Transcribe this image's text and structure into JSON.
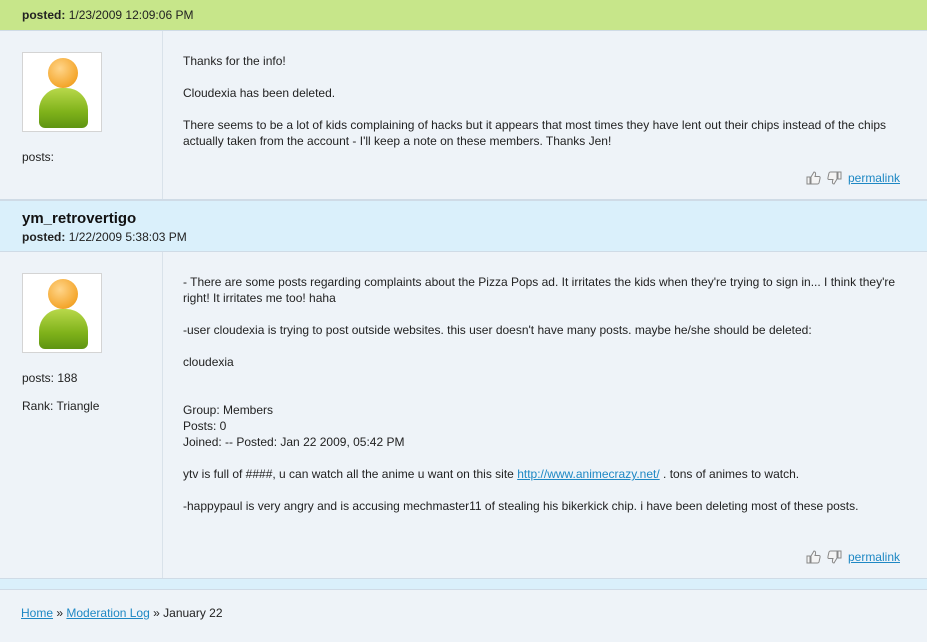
{
  "post1": {
    "posted_label": "posted:",
    "posted_value": "1/23/2009 12:09:06 PM",
    "user": {
      "posts_label": "posts:",
      "posts_value": ""
    },
    "paragraphs": [
      "Thanks for the info!",
      "Cloudexia has been deleted.",
      "There seems to be a lot of kids complaining of hacks but it appears that most times they have lent out their chips instead of the chips actually taken from the account - I'll keep a note on these members. Thanks Jen!"
    ],
    "permalink": "permalink"
  },
  "post2": {
    "author": "ym_retrovertigo",
    "posted_label": "posted:",
    "posted_value": "1/22/2009 5:38:03 PM",
    "user": {
      "posts_label": "posts:",
      "posts_value": "188",
      "rank_label": "Rank:",
      "rank_value": "Triangle"
    },
    "p1": "- There are some posts regarding complaints about the Pizza Pops ad. It irritates the kids when they're trying to sign in... I think they're right! It irritates me too! haha",
    "p2": "-user cloudexia is trying to post outside websites. this user doesn't have many posts. maybe he/she should be deleted:",
    "p3": "cloudexia",
    "group_line": "Group: Members",
    "posts_line": "Posts: 0",
    "joined_line": "Joined: -- Posted: Jan 22 2009, 05:42 PM",
    "p5_before": "ytv is full of ####, u can watch all the anime u want on this site ",
    "p5_link": "http://www.animecrazy.net/",
    "p5_after": " . tons of animes to watch.",
    "p6": "-happypaul is very angry and is accusing mechmaster11 of stealing his bikerkick chip. i have been deleting most of these posts.",
    "permalink": "permalink"
  },
  "breadcrumb": {
    "home": "Home",
    "sep": "»",
    "moderation_log": "Moderation Log",
    "current": "January 22"
  },
  "icons": {
    "thumb_up": "thumbs-up-icon",
    "thumb_down": "thumbs-down-icon",
    "avatar": "default-user-avatar"
  },
  "colors": {
    "header_green": "#c7e68a",
    "header_blue": "#daf0fb",
    "body_bg": "#eef3f8",
    "link": "#1e88c4"
  }
}
